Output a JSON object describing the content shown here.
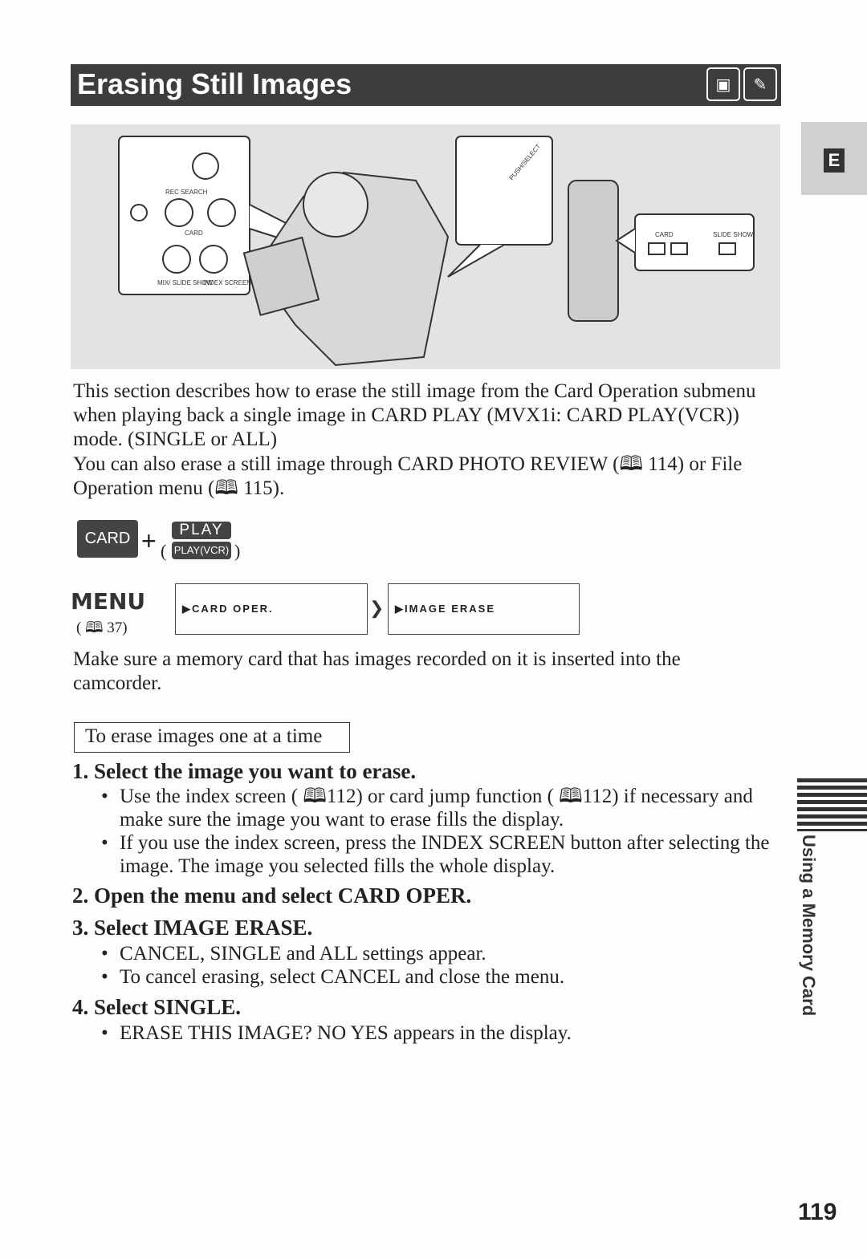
{
  "header": {
    "title": "Erasing Still Images",
    "icons": [
      "card-play-icon",
      "remote-icon"
    ]
  },
  "illustration": {
    "labels": [
      "REC SEARCH",
      "CARD",
      "MIX/ SLIDE SHOW",
      "INDEX SCREEN",
      "PUSH/SELECT",
      "CARD",
      "SLIDE SHOW"
    ]
  },
  "side_tab": {
    "letter": "E",
    "section": "Using a Memory Card",
    "stripe_color": "#333333"
  },
  "intro": [
    "This section describes how to erase the still image from the Card Operation submenu when playing back a single image in CARD PLAY (MVX1i: CARD PLAY(VCR)) mode. (SINGLE or ALL)",
    "You can also erase a still image through CARD PHOTO REVIEW (🕮 114) or File Operation menu (🕮 115)."
  ],
  "intro_parts": {
    "line2a": "You can also erase a still image through CARD PHOTO REVIEW (",
    "line2b": " 114) or File Operation menu (",
    "line2c": " 115)."
  },
  "keys": {
    "card": "CARD",
    "plus": "+",
    "open": "(",
    "play": "PLAY",
    "play_vcr": "PLAY(VCR)",
    "close": ")"
  },
  "menu": {
    "label": "MENU",
    "ref": "37",
    "box1": "▶CARD OPER.",
    "box2": "▶IMAGE ERASE"
  },
  "note": "Make sure a memory card that has images recorded on it is inserted into the camcorder.",
  "subheading": "To erase images one at a time",
  "steps": [
    {
      "title": "1. Select the image you want to erase.",
      "bullets": [
        "Use the index screen ( 112) or card jump function ( 112) if necessary and make sure the image you want to erase fills the display.",
        "If you use the index screen, press the INDEX SCREEN button after selecting the image. The image you selected fills the whole display."
      ]
    },
    {
      "title": "2. Open the menu and select CARD OPER.",
      "bullets": []
    },
    {
      "title": "3. Select IMAGE ERASE.",
      "bullets": [
        "CANCEL, SINGLE and ALL settings appear.",
        "To cancel erasing, select CANCEL and close the menu."
      ]
    },
    {
      "title": "4. Select SINGLE.",
      "bullets": [
        "ERASE THIS IMAGE? NO YES appears in the display."
      ]
    }
  ],
  "page_number": "119"
}
